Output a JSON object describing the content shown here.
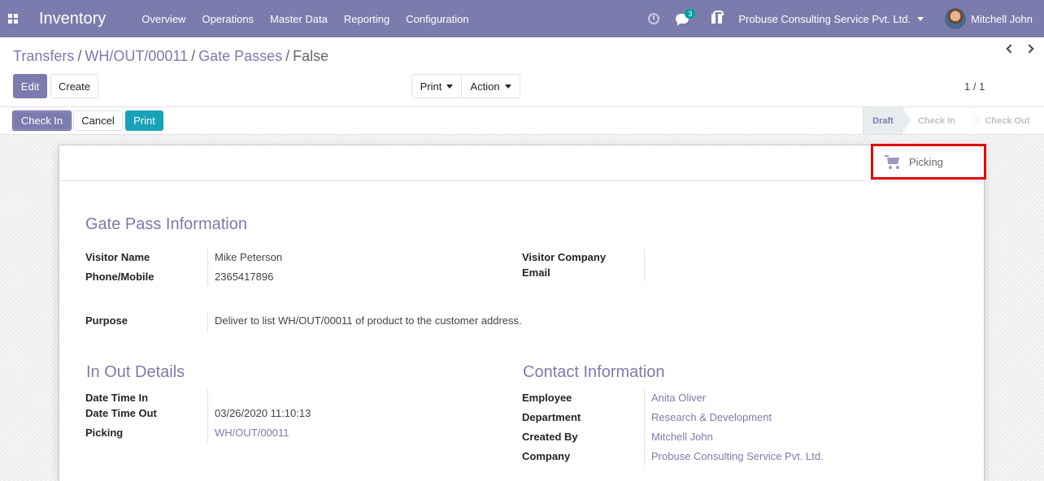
{
  "navbar": {
    "app_name": "Inventory",
    "menu": [
      "Overview",
      "Operations",
      "Master Data",
      "Reporting",
      "Configuration"
    ],
    "chat_count": "3",
    "company": "Probuse Consulting Service Pvt. Ltd.",
    "user": "Mitchell John",
    "colors": {
      "brand": "#7c7bad",
      "badge": "#00a09d"
    }
  },
  "breadcrumb": {
    "items": [
      "Transfers",
      "WH/OUT/00011",
      "Gate Passes"
    ],
    "current": "False"
  },
  "toolbar": {
    "edit_label": "Edit",
    "create_label": "Create",
    "print_label": "Print",
    "action_label": "Action",
    "pager": "1 / 1"
  },
  "statusbar": {
    "buttons": {
      "check_in": "Check In",
      "cancel": "Cancel",
      "print": "Print"
    },
    "stages": [
      "Draft",
      "Check In",
      "Check Out"
    ],
    "active_stage": "Draft"
  },
  "smart_button": {
    "label": "Picking",
    "icon": "shopping-cart-icon"
  },
  "gate_pass": {
    "title": "Gate Pass Information",
    "visitor_name_label": "Visitor Name",
    "visitor_name": "Mike Peterson",
    "phone_label": "Phone/Mobile",
    "phone": "2365417896",
    "visitor_company_label": "Visitor Company",
    "email_label": "Email",
    "purpose_label": "Purpose",
    "purpose": "Deliver to list WH/OUT/00011 of product to the customer address."
  },
  "in_out": {
    "title": "In Out Details",
    "date_in_label": "Date Time In",
    "date_out_label": "Date Time Out",
    "date_out": "03/26/2020 11:10:13",
    "picking_label": "Picking",
    "picking": "WH/OUT/00011"
  },
  "contact": {
    "title": "Contact Information",
    "employee_label": "Employee",
    "employee": "Anita Oliver",
    "department_label": "Department",
    "department": "Research & Development",
    "created_by_label": "Created By",
    "created_by": "Mitchell John",
    "company_label": "Company",
    "company": "Probuse Consulting Service Pvt. Ltd."
  }
}
